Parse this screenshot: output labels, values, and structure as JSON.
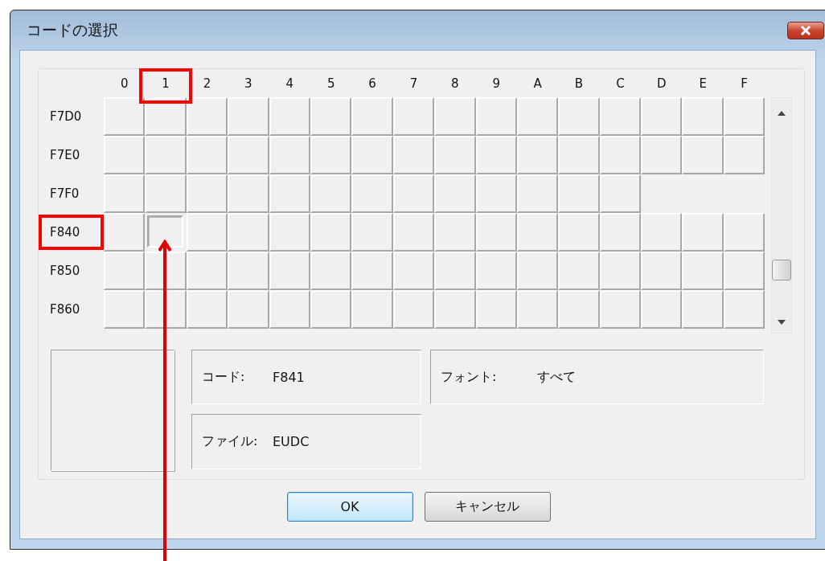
{
  "window": {
    "title": "コードの選択"
  },
  "grid": {
    "columns": [
      {
        "label": "0",
        "highlighted": false
      },
      {
        "label": "1",
        "highlighted": true
      },
      {
        "label": "2",
        "highlighted": false
      },
      {
        "label": "3",
        "highlighted": false
      },
      {
        "label": "4",
        "highlighted": false
      },
      {
        "label": "5",
        "highlighted": false
      },
      {
        "label": "6",
        "highlighted": false
      },
      {
        "label": "7",
        "highlighted": false
      },
      {
        "label": "8",
        "highlighted": false
      },
      {
        "label": "9",
        "highlighted": false
      },
      {
        "label": "A",
        "highlighted": false
      },
      {
        "label": "B",
        "highlighted": false
      },
      {
        "label": "C",
        "highlighted": false
      },
      {
        "label": "D",
        "highlighted": false
      },
      {
        "label": "E",
        "highlighted": false
      },
      {
        "label": "F",
        "highlighted": false
      }
    ],
    "rows": [
      {
        "label": "F7D0",
        "highlighted": false,
        "cells": [
          {
            "selected": false
          },
          {
            "selected": false
          },
          {
            "selected": false
          },
          {
            "selected": false
          },
          {
            "selected": false
          },
          {
            "selected": false
          },
          {
            "selected": false
          },
          {
            "selected": false
          },
          {
            "selected": false
          },
          {
            "selected": false
          },
          {
            "selected": false
          },
          {
            "selected": false
          },
          {
            "selected": false
          },
          {
            "selected": false
          },
          {
            "selected": false
          },
          {
            "selected": false
          }
        ]
      },
      {
        "label": "F7E0",
        "highlighted": false,
        "cells": [
          {
            "selected": false
          },
          {
            "selected": false
          },
          {
            "selected": false
          },
          {
            "selected": false
          },
          {
            "selected": false
          },
          {
            "selected": false
          },
          {
            "selected": false
          },
          {
            "selected": false
          },
          {
            "selected": false
          },
          {
            "selected": false
          },
          {
            "selected": false
          },
          {
            "selected": false
          },
          {
            "selected": false
          },
          {
            "selected": false
          },
          {
            "selected": false
          },
          {
            "selected": false
          }
        ]
      },
      {
        "label": "F7F0",
        "highlighted": false,
        "cells": [
          {
            "selected": false
          },
          {
            "selected": false
          },
          {
            "selected": false
          },
          {
            "selected": false
          },
          {
            "selected": false
          },
          {
            "selected": false
          },
          {
            "selected": false
          },
          {
            "selected": false
          },
          {
            "selected": false
          },
          {
            "selected": false
          },
          {
            "selected": false
          },
          {
            "selected": false
          },
          {
            "selected": false
          }
        ]
      },
      {
        "label": "F840",
        "highlighted": true,
        "cells": [
          {
            "selected": false
          },
          {
            "selected": true
          },
          {
            "selected": false
          },
          {
            "selected": false
          },
          {
            "selected": false
          },
          {
            "selected": false
          },
          {
            "selected": false
          },
          {
            "selected": false
          },
          {
            "selected": false
          },
          {
            "selected": false
          },
          {
            "selected": false
          },
          {
            "selected": false
          },
          {
            "selected": false
          },
          {
            "selected": false
          },
          {
            "selected": false
          },
          {
            "selected": false
          }
        ]
      },
      {
        "label": "F850",
        "highlighted": false,
        "cells": [
          {
            "selected": false
          },
          {
            "selected": false
          },
          {
            "selected": false
          },
          {
            "selected": false
          },
          {
            "selected": false
          },
          {
            "selected": false
          },
          {
            "selected": false
          },
          {
            "selected": false
          },
          {
            "selected": false
          },
          {
            "selected": false
          },
          {
            "selected": false
          },
          {
            "selected": false
          },
          {
            "selected": false
          },
          {
            "selected": false
          },
          {
            "selected": false
          },
          {
            "selected": false
          }
        ]
      },
      {
        "label": "F860",
        "highlighted": false,
        "cells": [
          {
            "selected": false
          },
          {
            "selected": false
          },
          {
            "selected": false
          },
          {
            "selected": false
          },
          {
            "selected": false
          },
          {
            "selected": false
          },
          {
            "selected": false
          },
          {
            "selected": false
          },
          {
            "selected": false
          },
          {
            "selected": false
          },
          {
            "selected": false
          },
          {
            "selected": false
          },
          {
            "selected": false
          },
          {
            "selected": false
          },
          {
            "selected": false
          },
          {
            "selected": false
          }
        ]
      }
    ]
  },
  "info": {
    "code": {
      "label": "コード:",
      "value": "F841"
    },
    "font": {
      "label": "フォント:",
      "value": "すべて"
    },
    "file": {
      "label": "ファイル:",
      "value": "EUDC"
    }
  },
  "buttons": [
    {
      "label": "OK",
      "default": true
    },
    {
      "label": "キャンセル",
      "default": false
    }
  ]
}
